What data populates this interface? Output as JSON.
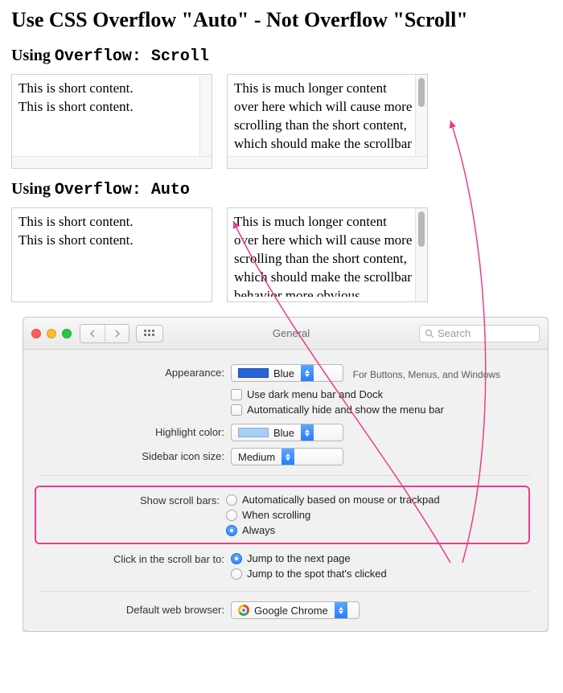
{
  "heading": "Use CSS Overflow \"Auto\" - Not Overflow \"Scroll\"",
  "section1": {
    "prefix": "Using ",
    "code": "Overflow: Scroll"
  },
  "section2": {
    "prefix": "Using ",
    "code": "Overflow: Auto"
  },
  "short_content": "This is short content.\nThis is short content.",
  "long_content": "This is much longer content over here which will cause more scrolling than the short content, which should make the scrollbar behavior more obvious.",
  "prefs": {
    "title": "General",
    "search_placeholder": "Search",
    "appearance": {
      "label": "Appearance:",
      "value": "Blue",
      "hint": "For Buttons, Menus, and Windows",
      "darkmenu": "Use dark menu bar and Dock",
      "autohide": "Automatically hide and show the menu bar"
    },
    "highlight": {
      "label": "Highlight color:",
      "value": "Blue"
    },
    "sidebar": {
      "label": "Sidebar icon size:",
      "value": "Medium"
    },
    "scrollbars": {
      "label": "Show scroll bars:",
      "opt1": "Automatically based on mouse or trackpad",
      "opt2": "When scrolling",
      "opt3": "Always"
    },
    "click": {
      "label": "Click in the scroll bar to:",
      "opt1": "Jump to the next page",
      "opt2": "Jump to the spot that's clicked"
    },
    "browser": {
      "label": "Default web browser:",
      "value": "Google Chrome"
    }
  }
}
